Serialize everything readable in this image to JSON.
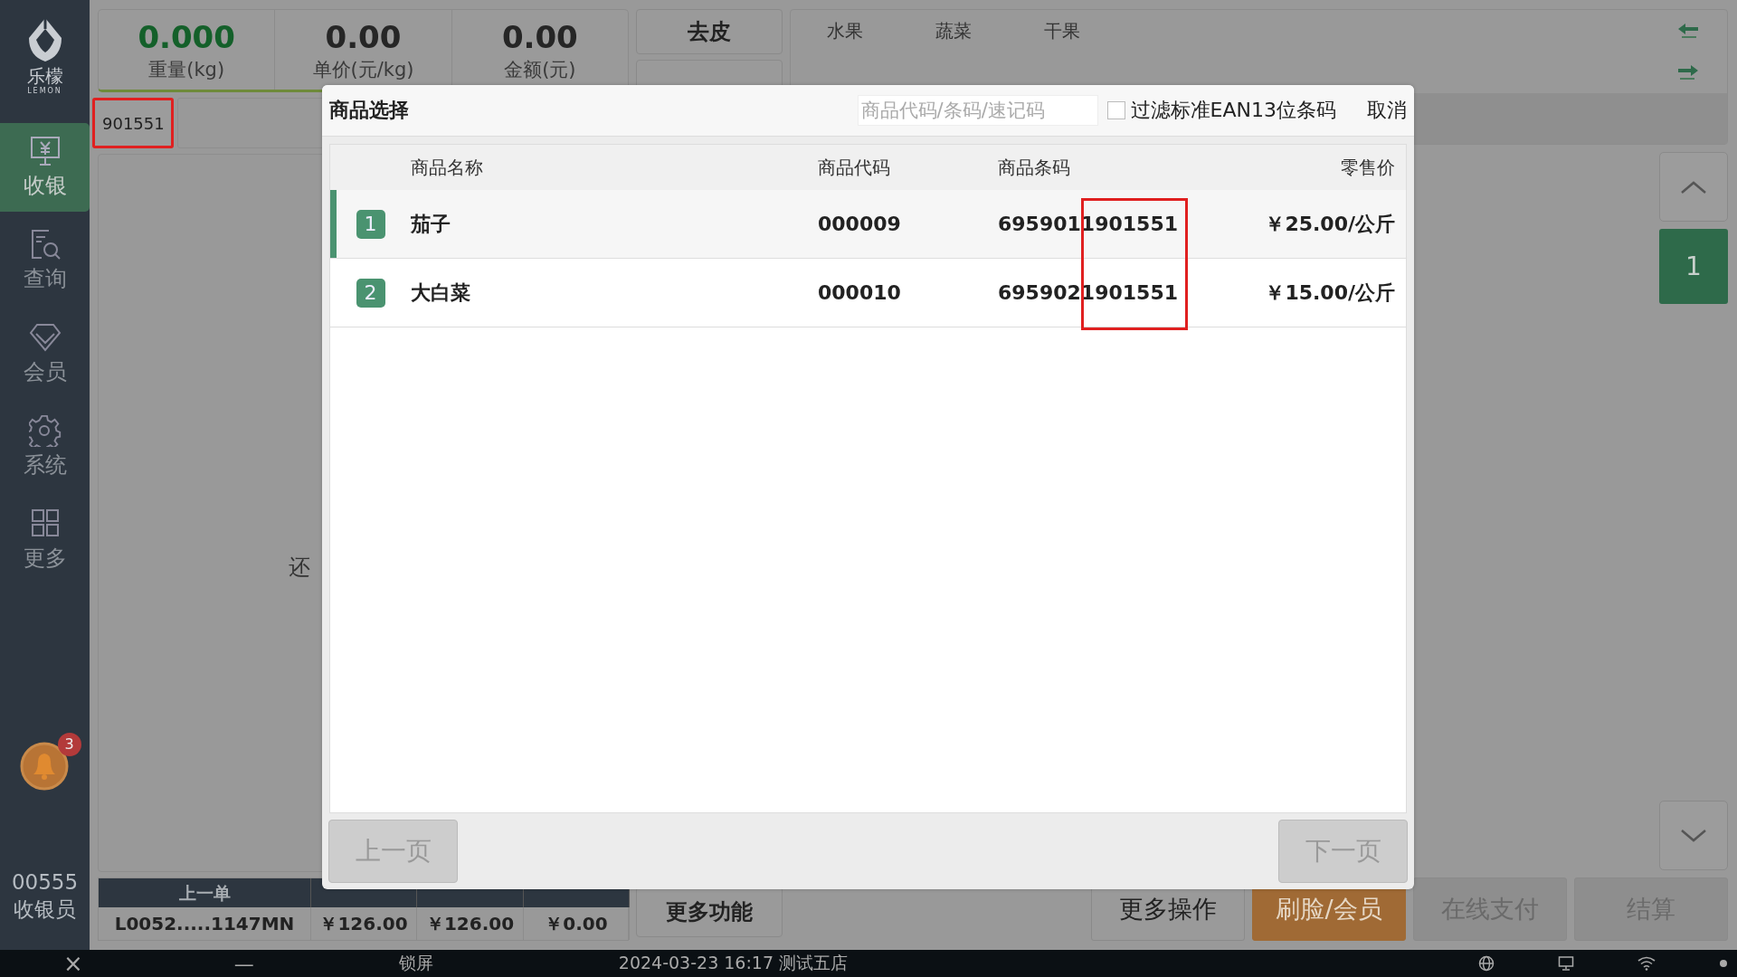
{
  "sidebar": {
    "logo": {
      "name": "乐檬",
      "subtitle": "LEMON"
    },
    "items": [
      {
        "label": "收银",
        "selected": true
      },
      {
        "label": "查询",
        "selected": false
      },
      {
        "label": "会员",
        "selected": false
      },
      {
        "label": "系统",
        "selected": false
      },
      {
        "label": "更多",
        "selected": false
      }
    ],
    "notification_count": "3",
    "user": {
      "id": "00555",
      "role": "收银员"
    }
  },
  "scale": [
    {
      "value": "0.000",
      "label": "重量(kg)",
      "kind": "weight"
    },
    {
      "value": "0.00",
      "label": "单价(元/kg)",
      "kind": "plain"
    },
    {
      "value": "0.00",
      "label": "金额(元)",
      "kind": "plain"
    }
  ],
  "scale_buttons": [
    "去皮"
  ],
  "categories": [
    {
      "label": "水果"
    },
    {
      "label": "蔬菜"
    },
    {
      "label": "干果"
    }
  ],
  "barcode_input": {
    "value": "901551",
    "highlighted": true
  },
  "empty_cart_text": "还",
  "cart_page": "1",
  "last_order": {
    "columns": [
      "上一单"
    ],
    "values": [
      "L0052.....1147MN",
      "￥126.00",
      "￥126.00",
      "￥0.00"
    ]
  },
  "more_functions_button": "更多功能",
  "actions": [
    {
      "label": "更多操作",
      "kind": "normal"
    },
    {
      "label": "刷脸/会员",
      "kind": "primary"
    },
    {
      "label": "在线支付",
      "kind": "disabled"
    },
    {
      "label": "结算",
      "kind": "disabled"
    }
  ],
  "dialog": {
    "title": "商品选择",
    "search": {
      "placeholder": "商品代码/条码/速记码"
    },
    "filter": {
      "label": "过滤标准EAN13位条码",
      "checked": false
    },
    "cancel": "取消",
    "columns": [
      "商品名称",
      "商品代码",
      "商品条码",
      "零售价"
    ],
    "barcode_highlighted": true,
    "rows": [
      {
        "index": "1",
        "name": "茄子",
        "code": "000009",
        "barcode": "6959011901551",
        "price": "￥25.00/公斤",
        "selected": true
      },
      {
        "index": "2",
        "name": "大白菜",
        "code": "000010",
        "barcode": "6959021901551",
        "price": "￥15.00/公斤",
        "selected": false
      }
    ],
    "prev_button": {
      "label": "上一页",
      "disabled": true
    },
    "next_button": {
      "label": "下一页",
      "disabled": true
    }
  },
  "taskbar": {
    "close": "×",
    "minimize": "—",
    "lock": "锁屏",
    "status": "2024-03-23 16:17 测试五店"
  }
}
